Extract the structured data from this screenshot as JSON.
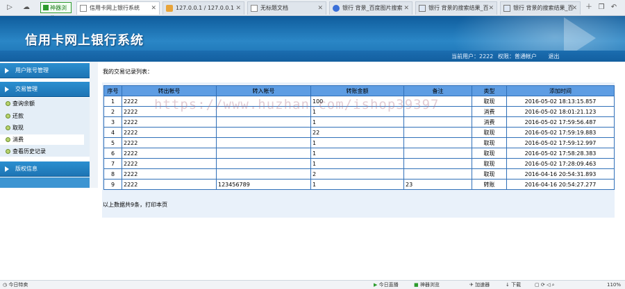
{
  "browser": {
    "special_tab": "神器浏览",
    "tabs": [
      {
        "title": "信用卡网上银行系统",
        "active": true
      },
      {
        "title": "127.0.0.1 / 127.0.0.1",
        "active": false
      },
      {
        "title": "无标题文档",
        "active": false
      },
      {
        "title": "银行 背景_百度图片搜索",
        "active": false
      },
      {
        "title": "银行 背景的搜索结果_百",
        "active": false
      },
      {
        "title": "银行 背景的搜索结果_百",
        "active": false
      }
    ],
    "toolbar_icons": [
      "plus-icon",
      "copy-icon",
      "undo-icon"
    ]
  },
  "header": {
    "title": "信用卡网上银行系统",
    "user_label": "当前用户：2222",
    "role_label": "权限：普通帐户",
    "logout": "退出"
  },
  "sidebar": {
    "sections": [
      {
        "label": "用户账号管理"
      },
      {
        "label": "交易管理"
      },
      {
        "label": "版权信息"
      }
    ],
    "trade_items": [
      {
        "label": "查询余额"
      },
      {
        "label": "还款"
      },
      {
        "label": "取现"
      },
      {
        "label": "消费"
      },
      {
        "label": "查看历史记录"
      }
    ],
    "selected_item": "消费"
  },
  "main": {
    "section_title": "我的交易记录列表：",
    "columns": [
      "序号",
      "转出帐号",
      "转入帐号",
      "转账金额",
      "备注",
      "类型",
      "添加时间"
    ],
    "rows": [
      [
        "1",
        "2222",
        "",
        "100",
        "",
        "取现",
        "2016-05-02 18:13:15.857"
      ],
      [
        "2",
        "2222",
        "",
        "1",
        "",
        "消费",
        "2016-05-02 18:01:21.123"
      ],
      [
        "3",
        "2222",
        "",
        "1",
        "",
        "消费",
        "2016-05-02 17:59:56.487"
      ],
      [
        "4",
        "2222",
        "",
        "22",
        "",
        "取现",
        "2016-05-02 17:59:19.883"
      ],
      [
        "5",
        "2222",
        "",
        "1",
        "",
        "取现",
        "2016-05-02 17:59:12.997"
      ],
      [
        "6",
        "2222",
        "",
        "1",
        "",
        "取现",
        "2016-05-02 17:58:28.383"
      ],
      [
        "7",
        "2222",
        "",
        "1",
        "",
        "取现",
        "2016-05-02 17:28:09.463"
      ],
      [
        "8",
        "2222",
        "",
        "2",
        "",
        "取现",
        "2016-04-16 20:54:31.893"
      ],
      [
        "9",
        "2222",
        "123456789",
        "1",
        "23",
        "转账",
        "2016-04-16 20:54:27.277"
      ]
    ],
    "summary": "以上数据共9条，打印本页",
    "watermark": "https://www.huzhan.com/ishop39397"
  },
  "statusbar": {
    "left": "今日特卖",
    "items": [
      "今日直播",
      "神器浏览",
      "加速器",
      "下载"
    ],
    "zoom": "110%"
  },
  "colors": {
    "banner": "#1a72b4",
    "table_header": "#5e9de3",
    "table_border": "#2f6fb8",
    "sidebar_head": "#2b8fd0"
  }
}
